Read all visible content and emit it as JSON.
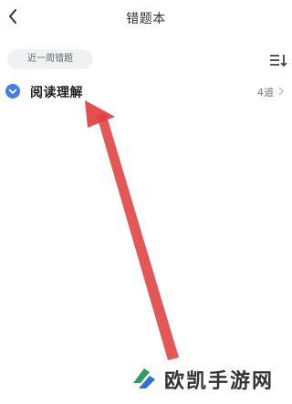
{
  "header": {
    "back_icon": "chevron-left-icon",
    "title": "错题本"
  },
  "filter": {
    "chip_label": "近一周错题",
    "sort_icon": "sort-list-icon"
  },
  "subjects": [
    {
      "name": "阅读理解",
      "count": "4道",
      "checked": true,
      "check_color": "#3f7fe0"
    }
  ],
  "annotation": {
    "arrow_color": "#e04040"
  },
  "watermark": {
    "text": "欧凯手游网",
    "logo_colors": [
      "#2e9f5a",
      "#2e6fd0"
    ]
  }
}
